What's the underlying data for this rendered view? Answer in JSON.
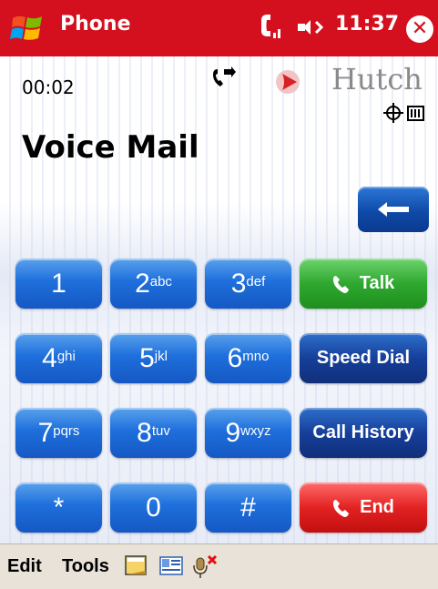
{
  "title_bar": {
    "app_title": "Phone",
    "clock": "11:37",
    "close_symbol": "✕",
    "icons": [
      "windows-start-icon",
      "signal-icon",
      "speaker-icon",
      "close-icon"
    ]
  },
  "status": {
    "call_timer": "00:02",
    "carrier_name": "Hutch",
    "icons": [
      "call-forward-icon",
      "carrier-logo-icon",
      "gps-icon",
      "battery-icon"
    ]
  },
  "call": {
    "title": "Voice Mail"
  },
  "keypad": {
    "keys": [
      {
        "digit": "1",
        "letters": ""
      },
      {
        "digit": "2",
        "letters": "abc"
      },
      {
        "digit": "3",
        "letters": "def"
      },
      {
        "digit": "4",
        "letters": "ghi"
      },
      {
        "digit": "5",
        "letters": "jkl"
      },
      {
        "digit": "6",
        "letters": "mno"
      },
      {
        "digit": "7",
        "letters": "pqrs"
      },
      {
        "digit": "8",
        "letters": "tuv"
      },
      {
        "digit": "9",
        "letters": "wxyz"
      },
      {
        "digit": "*",
        "letters": ""
      },
      {
        "digit": "0",
        "letters": ""
      },
      {
        "digit": "#",
        "letters": ""
      }
    ]
  },
  "actions": {
    "talk_label": "Talk",
    "speed_dial_label": "Speed Dial",
    "call_history_label": "Call History",
    "end_label": "End"
  },
  "menu": {
    "edit_label": "Edit",
    "tools_label": "Tools",
    "icons": [
      "note-icon",
      "contact-card-icon",
      "mute-mic-icon"
    ]
  },
  "colors": {
    "title_bar": "#d40f1e",
    "key_blue": "#1e6fdc",
    "talk_green": "#2fa82f",
    "end_red": "#e32222",
    "dark_blue": "#163f9a",
    "menu_bar": "#e8e2d8"
  }
}
